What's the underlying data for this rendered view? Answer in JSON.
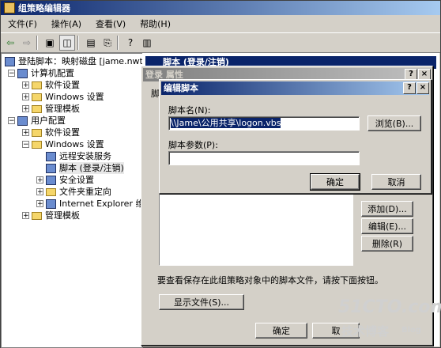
{
  "window": {
    "title": "组策略编辑器"
  },
  "menu": [
    "文件(F)",
    "操作(A)",
    "查看(V)",
    "帮助(H)"
  ],
  "tree": {
    "root": "登陆脚本：映射磁盘 [jame.nwtr",
    "computer": "计算机配置",
    "c_software": "软件设置",
    "c_windows": "Windows 设置",
    "c_admin": "管理模板",
    "user": "用户配置",
    "u_software": "软件设置",
    "u_windows": "Windows 设置",
    "remote": "远程安装服务",
    "scripts": "脚本 (登录/注销)",
    "security": "安全设置",
    "redirect": "文件夹重定向",
    "ie": "Internet Explorer 维",
    "u_admin": "管理模板"
  },
  "right": {
    "header": "脚本 (登录/注销)"
  },
  "logon": {
    "title": "登录 属性",
    "tab": "脚",
    "add": "添加(D)...",
    "edit": "编辑(E)...",
    "remove": "删除(R)",
    "note": "要查看保存在此组策略对象中的脚本文件，请按下面按钮。",
    "show": "显示文件(S)...",
    "ok": "确定",
    "cancel": "取"
  },
  "edit": {
    "title": "编辑脚本",
    "name_label": "脚本名(N):",
    "name_value": "\\\\Jame\\公用共享\\logon.vbs",
    "browse": "浏览(B)...",
    "param_label": "脚本参数(P):",
    "param_value": "",
    "ok": "确定",
    "cancel": "取消"
  },
  "titlebar_buttons": {
    "help": "?",
    "close": "×"
  },
  "watermark": {
    "site": "51CTO.com",
    "sub": "技术博客",
    "blog": "Blog"
  }
}
